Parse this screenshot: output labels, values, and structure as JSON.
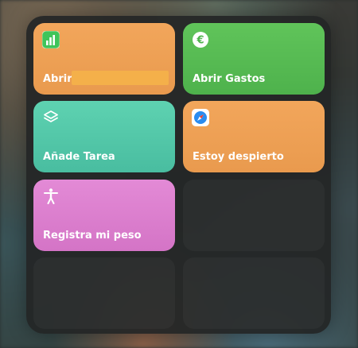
{
  "shortcuts": [
    {
      "label": "Abrir",
      "icon": "numbers-app-icon",
      "color": "#f0a058"
    },
    {
      "label": "Abrir Gastos",
      "icon": "euro-icon",
      "color": "#58bc53"
    },
    {
      "label": "Añade Tarea",
      "icon": "layers-icon",
      "color": "#55c9a9"
    },
    {
      "label": "Estoy despierto",
      "icon": "safari-compass-icon",
      "color": "#ec9f50"
    },
    {
      "label": "Registra mi peso",
      "icon": "accessibility-person-icon",
      "color": "#dc7fcf"
    }
  ]
}
